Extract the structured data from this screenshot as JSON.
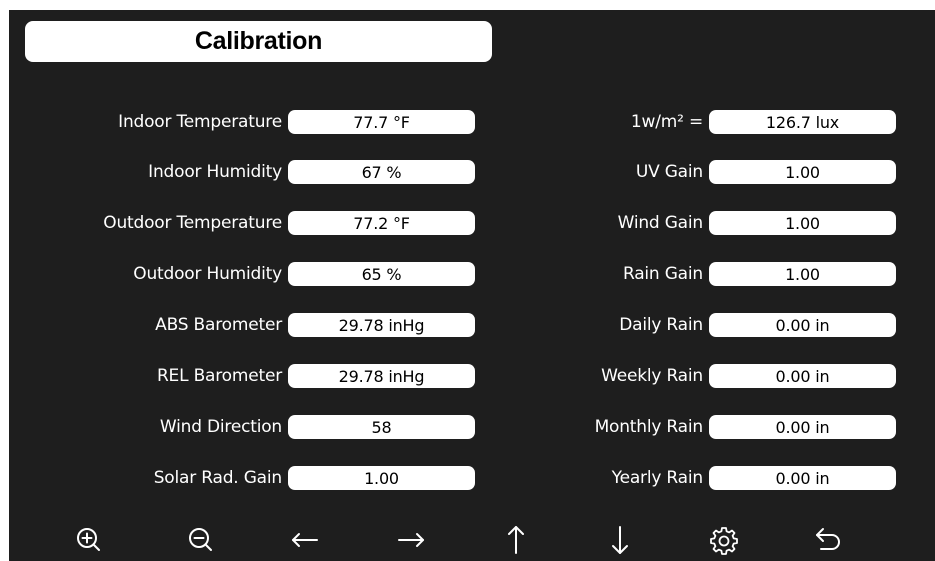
{
  "title": "Calibration",
  "left_fields": [
    {
      "label": "Indoor Temperature",
      "value": "77.7 °F"
    },
    {
      "label": "Indoor Humidity",
      "value": "67 %"
    },
    {
      "label": "Outdoor Temperature",
      "value": "77.2 °F"
    },
    {
      "label": "Outdoor Humidity",
      "value": "65 %"
    },
    {
      "label": "ABS Barometer",
      "value": "29.78 inHg"
    },
    {
      "label": "REL Barometer",
      "value": "29.78 inHg"
    },
    {
      "label": "Wind Direction",
      "value": "58"
    },
    {
      "label": "Solar Rad. Gain",
      "value": "1.00"
    }
  ],
  "right_fields": [
    {
      "label": "1w/m² =",
      "value": "126.7 lux"
    },
    {
      "label": "UV Gain",
      "value": "1.00"
    },
    {
      "label": "Wind Gain",
      "value": "1.00"
    },
    {
      "label": "Rain Gain",
      "value": "1.00"
    },
    {
      "label": "Daily Rain",
      "value": "0.00 in"
    },
    {
      "label": "Weekly Rain",
      "value": "0.00 in"
    },
    {
      "label": "Monthly Rain",
      "value": "0.00 in"
    },
    {
      "label": "Yearly Rain",
      "value": "0.00 in"
    }
  ],
  "toolbar": [
    {
      "icon": "zoom-in-icon"
    },
    {
      "icon": "zoom-out-icon"
    },
    {
      "icon": "arrow-left-icon"
    },
    {
      "icon": "arrow-right-icon"
    },
    {
      "icon": "arrow-up-icon"
    },
    {
      "icon": "arrow-down-icon"
    },
    {
      "icon": "gear-icon"
    },
    {
      "icon": "return-icon"
    }
  ],
  "colors": {
    "background": "#1e1e1e",
    "field_fill": "#ffffff",
    "text": "#ffffff",
    "field_text": "#000000"
  }
}
